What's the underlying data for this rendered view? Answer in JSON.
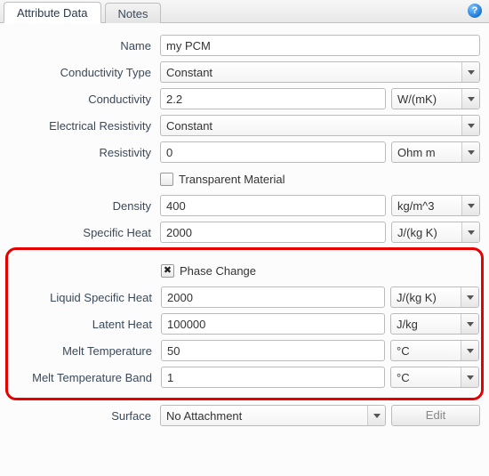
{
  "tabs": {
    "attribute": "Attribute Data",
    "notes": "Notes"
  },
  "help_glyph": "?",
  "labels": {
    "name": "Name",
    "conductivity_type": "Conductivity Type",
    "conductivity": "Conductivity",
    "electrical_resistivity": "Electrical Resistivity",
    "resistivity": "Resistivity",
    "transparent_material": "Transparent Material",
    "density": "Density",
    "specific_heat": "Specific Heat",
    "phase_change": "Phase Change",
    "liquid_specific_heat": "Liquid Specific Heat",
    "latent_heat": "Latent Heat",
    "melt_temperature": "Melt Temperature",
    "melt_temperature_band": "Melt Temperature Band",
    "surface": "Surface",
    "edit": "Edit"
  },
  "values": {
    "name": "my PCM",
    "conductivity_type": "Constant",
    "conductivity": "2.2",
    "electrical_resistivity": "Constant",
    "resistivity": "0",
    "density": "400",
    "specific_heat": "2000",
    "liquid_specific_heat": "2000",
    "latent_heat": "100000",
    "melt_temperature": "50",
    "melt_temperature_band": "1",
    "surface": "No Attachment"
  },
  "units": {
    "conductivity": "W/(mK)",
    "resistivity": "Ohm m",
    "density": "kg/m^3",
    "specific_heat": "J/(kg K)",
    "liquid_specific_heat": "J/(kg K)",
    "latent_heat": "J/kg",
    "melt_temperature": "°C",
    "melt_temperature_band": "°C"
  },
  "checkbox_state": {
    "transparent_material": "",
    "phase_change": "✖"
  }
}
